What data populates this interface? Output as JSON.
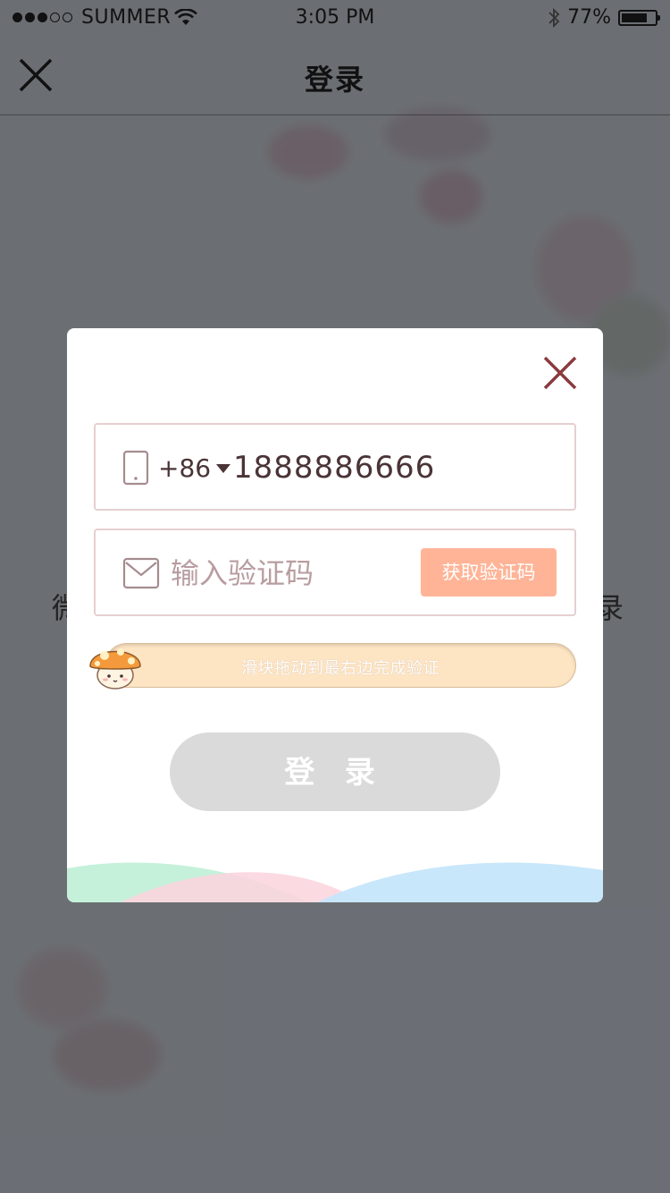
{
  "status_bar": {
    "carrier": "SUMMER",
    "time": "3:05 PM",
    "battery_percent": "77%",
    "battery_level": 0.77,
    "signal_dots_filled": 3,
    "signal_dots_total": 5
  },
  "nav": {
    "title": "登录",
    "close_icon": "close-icon"
  },
  "background": {
    "left_fragment": "微",
    "right_fragment": "录"
  },
  "modal": {
    "close_icon": "close-icon",
    "phone": {
      "country_code": "+86",
      "value": "1888886666",
      "icon": "phone-icon"
    },
    "code": {
      "placeholder": "输入验证码",
      "get_code_label": "获取验证码",
      "icon": "mail-icon"
    },
    "slider": {
      "hint": "滑块拖动到最右边完成验证",
      "handle_icon": "mushroom-icon"
    },
    "login_label": "登 录"
  },
  "colors": {
    "accent_orange": "#ffb497",
    "field_border": "#e6cfd0",
    "close_red": "#8b3a3e",
    "slider_fill": "#fde4c3",
    "button_disabled": "#dadada"
  }
}
